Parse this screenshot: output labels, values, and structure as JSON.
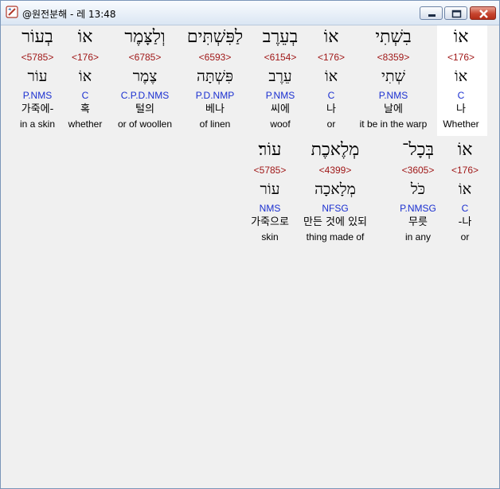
{
  "window": {
    "title": "@원전분해 - 레 13:48"
  },
  "colors": {
    "hebrew": "#000000",
    "strongs": "#a01818",
    "morph": "#1a2fd0",
    "highlight_bg": "#ffffff"
  },
  "rows": [
    [
      {
        "heb": "אוֹ",
        "num": "<176>",
        "lemma": "אוֹ",
        "morph": "C",
        "kor": "나",
        "eng": "Whether",
        "highlight": true
      },
      {
        "heb": "בִשְׁתִי",
        "num": "<8359>",
        "lemma": "שְׁתִי",
        "morph": "P.NMS",
        "kor": "날에",
        "eng": "it be in the warp"
      },
      {
        "heb": "אוֹ",
        "num": "<176>",
        "lemma": "אוֹ",
        "morph": "C",
        "kor": "나",
        "eng": "or"
      },
      {
        "heb": "בְעֵרֶב",
        "num": "<6154>",
        "lemma": "עֵרֶב",
        "morph": "P.NMS",
        "kor": "씨에",
        "eng": "woof"
      },
      {
        "heb": "לַפִּשְׁתִּים",
        "num": "<6593>",
        "lemma": "פִּשְׁתָּה",
        "morph": "P.D.NMP",
        "kor": "베나",
        "eng": "of linen"
      },
      {
        "heb": "וְלַצָּמֶר",
        "num": "<6785>",
        "lemma": "צֶמֶר",
        "morph": "C.P.D.NMS",
        "kor": "털의",
        "eng": "or of woollen"
      },
      {
        "heb": "אוֹ",
        "num": "<176>",
        "lemma": "אוֹ",
        "morph": "C",
        "kor": "혹",
        "eng": "whether"
      },
      {
        "heb": "בְעוֹר",
        "num": "<5785>",
        "lemma": "עוֹר",
        "morph": "P.NMS",
        "kor": "가죽에-",
        "eng": "in a skin"
      }
    ],
    [
      {
        "heb": "אוֹ",
        "num": "<176>",
        "lemma": "אוֹ",
        "morph": "C",
        "kor": "-나",
        "eng": "or"
      },
      {
        "heb": "בְּכָל־",
        "num": "<3605>",
        "lemma": "כֹּל",
        "morph": "P.NMSG",
        "kor": "무릇",
        "eng": "in any"
      },
      {
        "heb": "מְלֶאכֶת",
        "num": "<4399>",
        "lemma": "מְלָאכָה",
        "morph": "NFSG",
        "kor": "만든 것에 있되",
        "eng": "thing made of"
      },
      {
        "heb": "עוֹר׃",
        "num": "<5785>",
        "lemma": "עוֹר",
        "morph": "NMS",
        "kor": "가죽으로",
        "eng": "skin"
      }
    ]
  ]
}
